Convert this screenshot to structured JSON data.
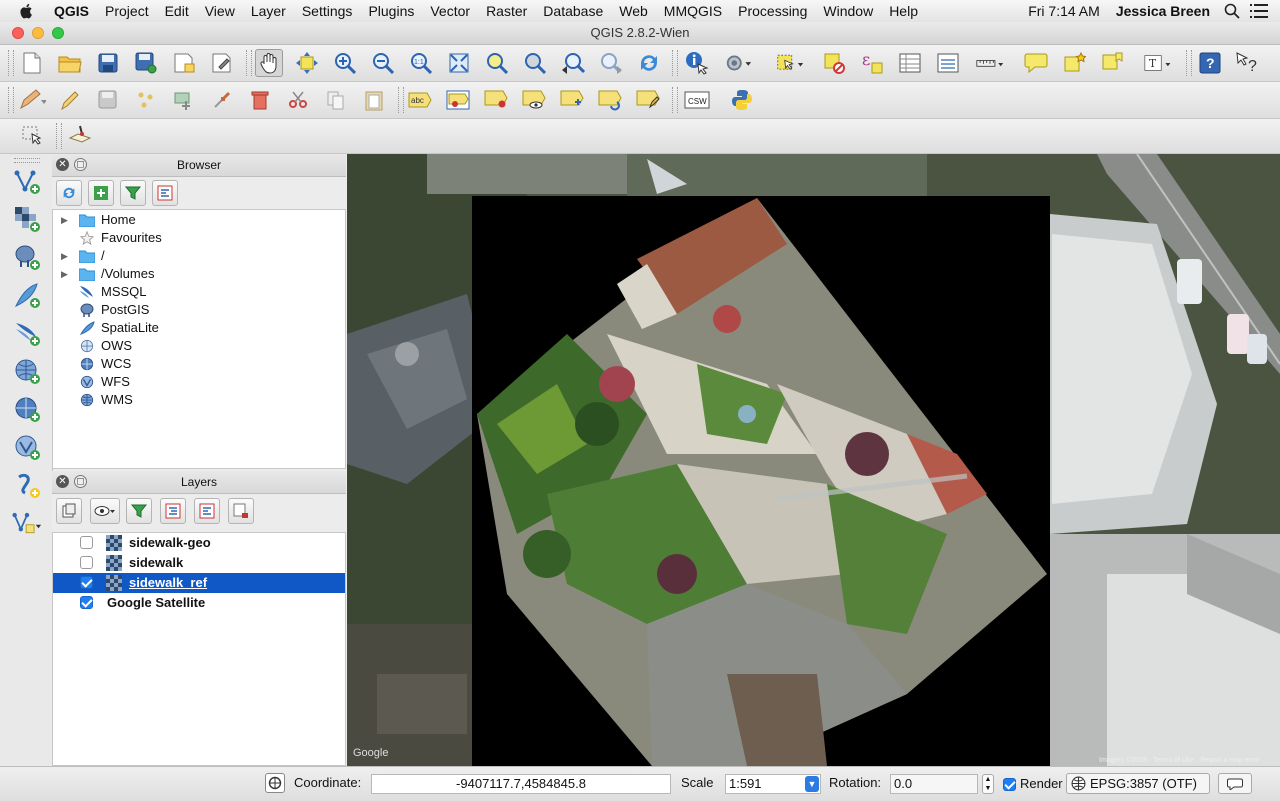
{
  "menubar": {
    "app_name": "QGIS",
    "items": [
      "Project",
      "Edit",
      "View",
      "Layer",
      "Settings",
      "Plugins",
      "Vector",
      "Raster",
      "Database",
      "Web",
      "MMQGIS",
      "Processing",
      "Window",
      "Help"
    ],
    "clock": "Fri 7:14 AM",
    "user": "Jessica Breen",
    "icons": [
      "apple-icon",
      "search-icon",
      "list-icon"
    ]
  },
  "window": {
    "title": "QGIS 2.8.2-Wien",
    "buttons": [
      "close",
      "minimize",
      "zoom"
    ],
    "colors": {
      "close": "#fc605b",
      "minimize": "#fdbc40",
      "zoom": "#34c84a"
    }
  },
  "toolbars": {
    "row1_icons": [
      "new-project",
      "open-project",
      "save-project",
      "save-as",
      "print-composer",
      "composer-manager",
      "pan",
      "pan-to-selection",
      "zoom-in",
      "zoom-out",
      "zoom-actual",
      "zoom-full",
      "zoom-to-selection",
      "zoom-to-layer",
      "zoom-last",
      "zoom-next",
      "refresh",
      "identify",
      "actions",
      "select",
      "deselect",
      "expression-select",
      "attribute-table",
      "statistics",
      "measure",
      "map-tips",
      "new-bookmark",
      "show-bookmarks",
      "text-annotation",
      "help",
      "whats-this"
    ],
    "row2_icons": [
      "current-edits",
      "toggle-editing",
      "save-edits",
      "add-feature",
      "move-feature",
      "node-tool",
      "delete-selected",
      "cut-features",
      "copy-features",
      "paste-features",
      "label",
      "layer-labeling",
      "pin-labels",
      "show-hide-labels",
      "move-label",
      "rotate-label",
      "change-label",
      "csw",
      "python-console"
    ],
    "row2_csw": "CSW",
    "row3_icons": [
      "georeferencer-select",
      "digitize-tool"
    ]
  },
  "left_tools": [
    "add-vector-layer",
    "add-raster-layer",
    "add-postgis-layer",
    "add-spatialite-layer",
    "add-mssql-layer",
    "add-wms-layer",
    "add-wcs-layer",
    "add-wfs-layer",
    "new-shapefile-layer",
    "new-spatialite-layer"
  ],
  "browser": {
    "title": "Browser",
    "tools": [
      "refresh-icon",
      "add-icon",
      "filter-icon",
      "collapse-icon"
    ],
    "items": [
      {
        "label": "Home",
        "expandable": true,
        "icon": "folder-icon"
      },
      {
        "label": "Favourites",
        "expandable": false,
        "icon": "star-icon"
      },
      {
        "label": "/",
        "expandable": true,
        "icon": "folder-icon"
      },
      {
        "label": "/Volumes",
        "expandable": true,
        "icon": "folder-icon"
      },
      {
        "label": "MSSQL",
        "expandable": false,
        "icon": "mssql-icon"
      },
      {
        "label": "PostGIS",
        "expandable": false,
        "icon": "postgis-icon"
      },
      {
        "label": "SpatiaLite",
        "expandable": false,
        "icon": "spatialite-icon"
      },
      {
        "label": "OWS",
        "expandable": false,
        "icon": "ows-icon"
      },
      {
        "label": "WCS",
        "expandable": false,
        "icon": "wcs-icon"
      },
      {
        "label": "WFS",
        "expandable": false,
        "icon": "wfs-icon"
      },
      {
        "label": "WMS",
        "expandable": false,
        "icon": "wms-icon"
      }
    ]
  },
  "layers": {
    "title": "Layers",
    "tools": [
      "add-group-icon",
      "visibility-icon",
      "filter-icon",
      "expand-icon",
      "collapse-icon",
      "remove-icon"
    ],
    "items": [
      {
        "label": "sidewalk-geo",
        "checked": false,
        "selected": false,
        "raster_icon": true
      },
      {
        "label": "sidewalk",
        "checked": false,
        "selected": false,
        "raster_icon": true
      },
      {
        "label": "sidewalk_ref",
        "checked": true,
        "selected": true,
        "raster_icon": true
      },
      {
        "label": "Google Satellite",
        "checked": true,
        "selected": false,
        "raster_icon": false
      }
    ]
  },
  "map": {
    "watermark": "Google",
    "attribution": "Imagery ©2015 · Terms of Use · Report a map error"
  },
  "status": {
    "coordinate_label": "Coordinate:",
    "coordinate_value": "-9407117.7,4584845.8",
    "scale_label": "Scale",
    "scale_value": "1:591",
    "rotation_label": "Rotation:",
    "rotation_value": "0.0",
    "render_label": "Render",
    "render_checked": true,
    "crs": "EPSG:3857 (OTF)"
  }
}
